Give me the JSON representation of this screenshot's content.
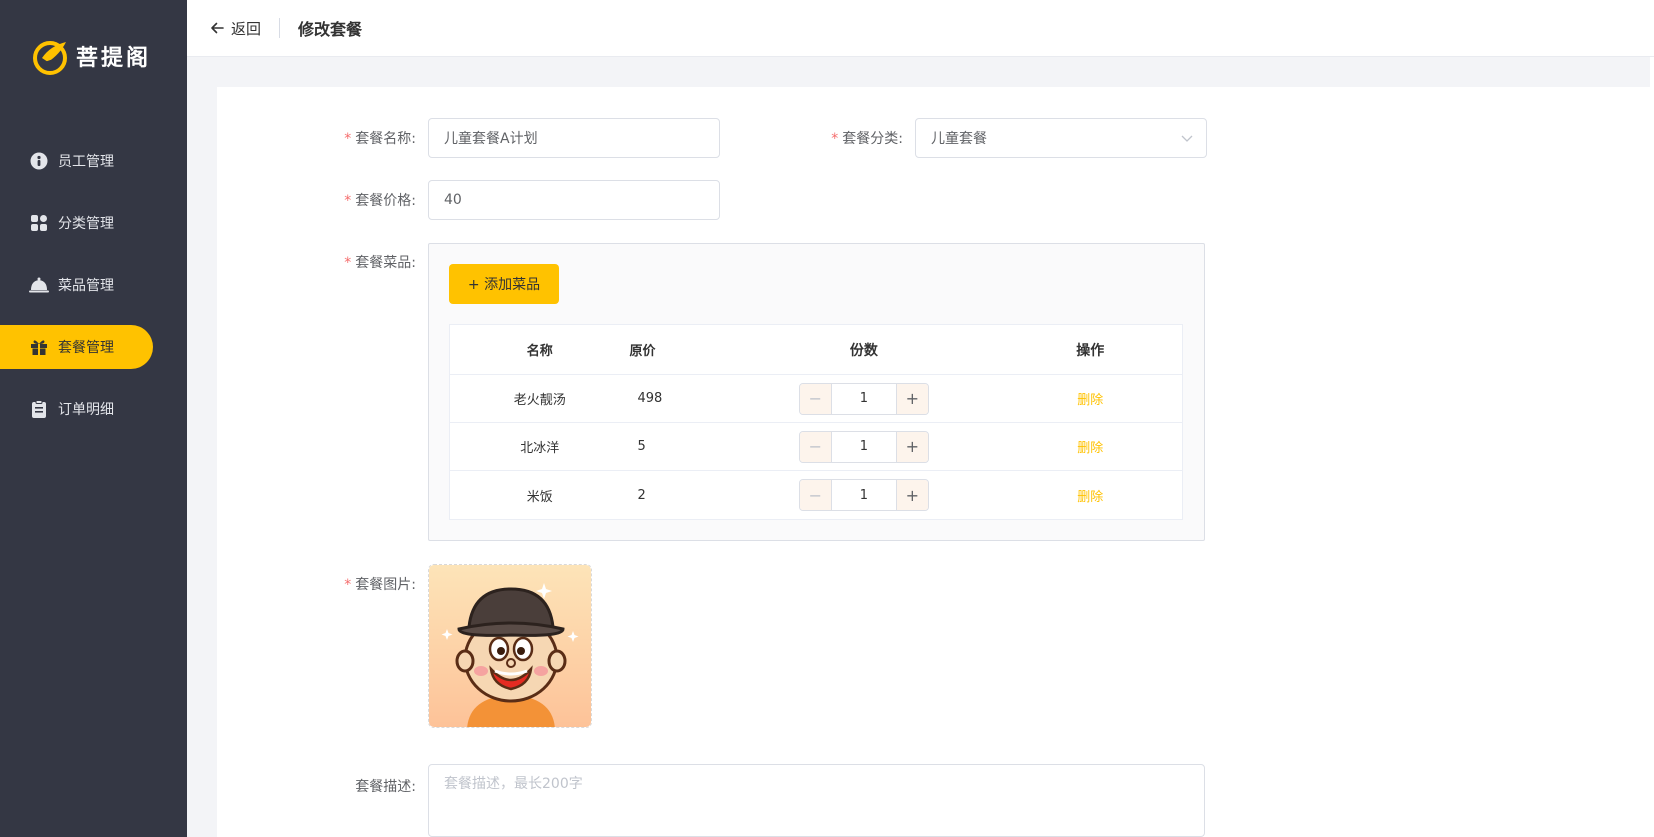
{
  "app": {
    "logo_text": "菩提阁"
  },
  "sidebar": {
    "items": [
      {
        "label": "员工管理",
        "icon": "employee-icon"
      },
      {
        "label": "分类管理",
        "icon": "category-icon"
      },
      {
        "label": "菜品管理",
        "icon": "dish-icon"
      },
      {
        "label": "套餐管理",
        "icon": "gift-icon",
        "active": true
      },
      {
        "label": "订单明细",
        "icon": "clipboard-icon"
      }
    ]
  },
  "header": {
    "back_label": "返回",
    "title": "修改套餐"
  },
  "form": {
    "name_label": "套餐名称:",
    "name_value": "儿童套餐A计划",
    "category_label": "套餐分类:",
    "category_value": "儿童套餐",
    "price_label": "套餐价格:",
    "price_value": "40",
    "dishes_label": "套餐菜品:",
    "add_dish_label": "+ 添加菜品",
    "image_label": "套餐图片:",
    "desc_label": "套餐描述:",
    "desc_placeholder": "套餐描述，最长200字"
  },
  "dish_table": {
    "headers": [
      "名称",
      "原价",
      "份数",
      "操作"
    ],
    "rows": [
      {
        "name": "老火靓汤",
        "price": "498",
        "copies": "1",
        "action": "删除"
      },
      {
        "name": "北冰洋",
        "price": "5",
        "copies": "1",
        "action": "删除"
      },
      {
        "name": "米饭",
        "price": "2",
        "copies": "1",
        "action": "删除"
      }
    ],
    "minus": "−",
    "plus": "+"
  },
  "colors": {
    "accent": "#ffc200",
    "sidebar_bg": "#343744",
    "required": "#f56c6c"
  }
}
